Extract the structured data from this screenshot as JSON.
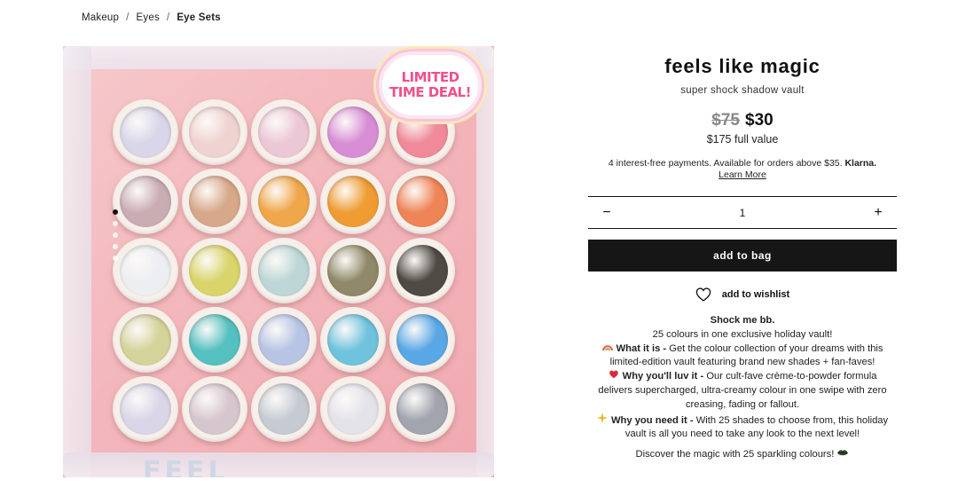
{
  "breadcrumb": {
    "items": [
      "Makeup",
      "Eyes",
      "Eye Sets"
    ],
    "separator": "/"
  },
  "product": {
    "title": "feels like magic",
    "subtitle": "super shock shadow vault",
    "old_price": "$75",
    "price": "$30",
    "full_value": "$175 full value",
    "klarna_text": "4 interest-free payments. Available for orders above $35.",
    "klarna_brand": "Klarna.",
    "learn_more": "Learn More",
    "quantity": "1",
    "minus_label": "−",
    "plus_label": "+",
    "add_to_bag": "add to bag",
    "wishlist": "add to wishlist"
  },
  "image": {
    "badge_line1": "LIMITED",
    "badge_line2": "TIME DEAL!",
    "bottom_text": "FEEL",
    "carousel_dots": 5,
    "active_dot": 0,
    "pans": [
      "#d9d6ea",
      "#efd3d1",
      "#ecc7d6",
      "#d78ed5",
      "#f08a9a",
      "#c9adb3",
      "#d7a88a",
      "#f0a64a",
      "#ef9c32",
      "#ef8457",
      "#eceef1",
      "#d9d56b",
      "#bcd7d6",
      "#8f8969",
      "#4e4a44",
      "#d4d39a",
      "#55c0c0",
      "#b7c4e3",
      "#6fc3dd",
      "#5aa7e6",
      "#dad6e8",
      "#d6c7cf",
      "#c6cbd3",
      "#e4e3ea",
      "#a2a5ae"
    ]
  },
  "description": {
    "intro": "Shock me bb.",
    "line2": "25 colours in one exclusive holiday vault!",
    "what_icon": "rainbow-icon",
    "what_label": "What it is -",
    "what_text": "Get the colour collection of your dreams with this limited-edition vault featuring brand new shades + fan-faves!",
    "why_icon": "heart-icon",
    "why_label": "Why you'll luv it -",
    "why_text": "Our cult-fave crème-to-powder formula delivers supercharged, ultra-creamy colour in one swipe with zero creasing, fading or fallout.",
    "need_icon": "sparkle-icon",
    "need_label": "Why you need it -",
    "need_text": "With 25 shades to choose from, this holiday vault is all you need to take any look to the next level!",
    "closing": "Discover the magic with 25 sparkling colours!",
    "closing_icon": "lips-icon"
  },
  "colors": {
    "button_bg": "#161616",
    "badge_pink": "#ef4f8c",
    "image_bg": "#f3b7bb"
  }
}
